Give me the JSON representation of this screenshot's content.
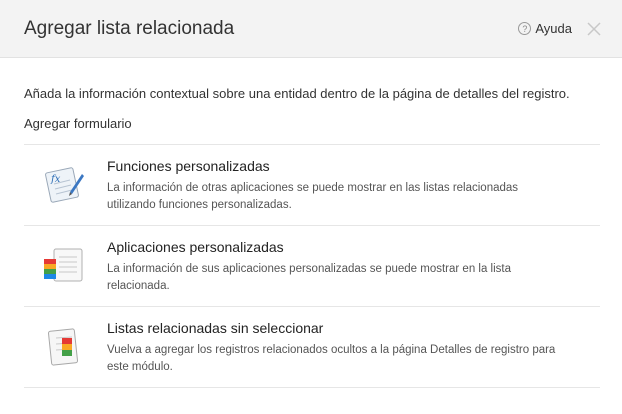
{
  "dialog": {
    "title": "Agregar lista relacionada",
    "help_label": "Ayuda"
  },
  "intro": "Añada la información contextual sobre una entidad dentro de la página de detalles del registro.",
  "section_label": "Agregar formulario",
  "options": [
    {
      "icon": "custom-function-icon",
      "title": "Funciones personalizadas",
      "description": "La información de otras aplicaciones se puede mostrar en las listas relacionadas utilizando funciones personalizadas."
    },
    {
      "icon": "custom-app-icon",
      "title": "Aplicaciones personalizadas",
      "description": "La información de sus aplicaciones personalizadas se puede mostrar en la lista relacionada."
    },
    {
      "icon": "related-list-icon",
      "title": "Listas relacionadas sin seleccionar",
      "description": "Vuelva a agregar los registros relacionados ocultos a la página Detalles de registro para este módulo."
    }
  ]
}
